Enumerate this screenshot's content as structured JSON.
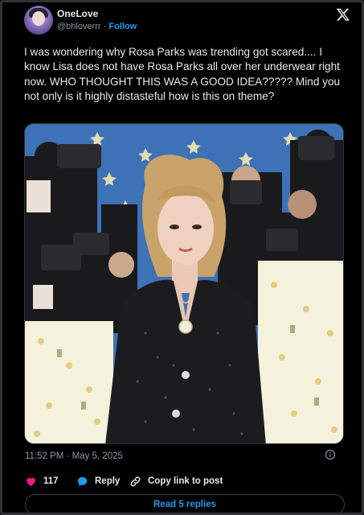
{
  "author": {
    "name": "OneLove",
    "handle": "@bhloverrr",
    "separator": "·",
    "follow_label": "Follow"
  },
  "tweet": {
    "text": "I was wondering why Rosa Parks was trending got scared.... I know Lisa does not have Rosa Parks all over her underwear right now. WHO THOUGHT THIS WAS A GOOD IDEA????? Mind you not only is it highly distasteful how is this on theme?"
  },
  "media": {
    "description_icon": "photo"
  },
  "meta": {
    "timestamp": "11:52 PM · May 5, 2025"
  },
  "actions": {
    "like_count": "117",
    "reply_label": "Reply",
    "copy_label": "Copy link to post"
  },
  "replies_button": "Read 5 replies",
  "colors": {
    "accent": "#1d9bf0",
    "like": "#f91880",
    "background": "#000000",
    "secondary_text": "#8b98a5"
  },
  "icons": [
    "x-logo-icon",
    "info-icon",
    "heart-icon",
    "reply-bubble-icon",
    "link-icon"
  ]
}
